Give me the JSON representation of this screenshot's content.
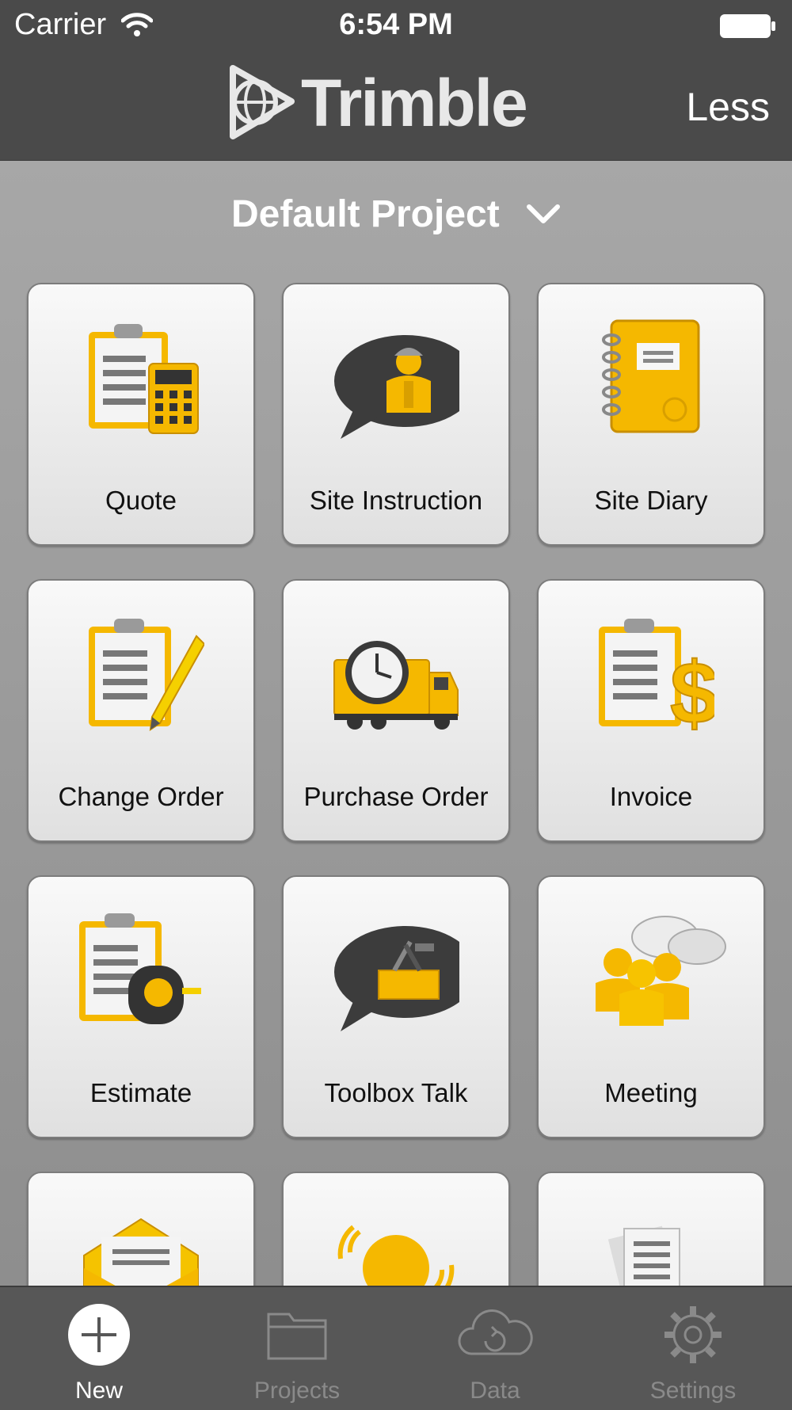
{
  "status_bar": {
    "carrier": "Carrier",
    "time": "6:54 PM"
  },
  "nav": {
    "brand": "Trimble",
    "less_label": "Less"
  },
  "project": {
    "name": "Default Project"
  },
  "tiles": [
    {
      "label": "Quote",
      "icon": "quote-icon"
    },
    {
      "label": "Site Instruction",
      "icon": "site-instruction-icon"
    },
    {
      "label": "Site Diary",
      "icon": "site-diary-icon"
    },
    {
      "label": "Change Order",
      "icon": "change-order-icon"
    },
    {
      "label": "Purchase Order",
      "icon": "purchase-order-icon"
    },
    {
      "label": "Invoice",
      "icon": "invoice-icon"
    },
    {
      "label": "Estimate",
      "icon": "estimate-icon"
    },
    {
      "label": "Toolbox Talk",
      "icon": "toolbox-talk-icon"
    },
    {
      "label": "Meeting",
      "icon": "meeting-icon"
    },
    {
      "label": "",
      "icon": "envelope-icon"
    },
    {
      "label": "",
      "icon": "lightbulb-icon"
    },
    {
      "label": "",
      "icon": "documents-hardhat-icon"
    }
  ],
  "tab_bar": {
    "tabs": [
      {
        "label": "New",
        "icon": "plus-circle-icon",
        "active": true
      },
      {
        "label": "Projects",
        "icon": "folder-icon",
        "active": false
      },
      {
        "label": "Data",
        "icon": "cloud-sync-icon",
        "active": false
      },
      {
        "label": "Settings",
        "icon": "gear-icon",
        "active": false
      }
    ]
  },
  "colors": {
    "bar": "#4a4a4a",
    "accent_yellow": "#f5b800",
    "tab_inactive": "#8a8a8a",
    "tab_active": "#ffffff"
  }
}
